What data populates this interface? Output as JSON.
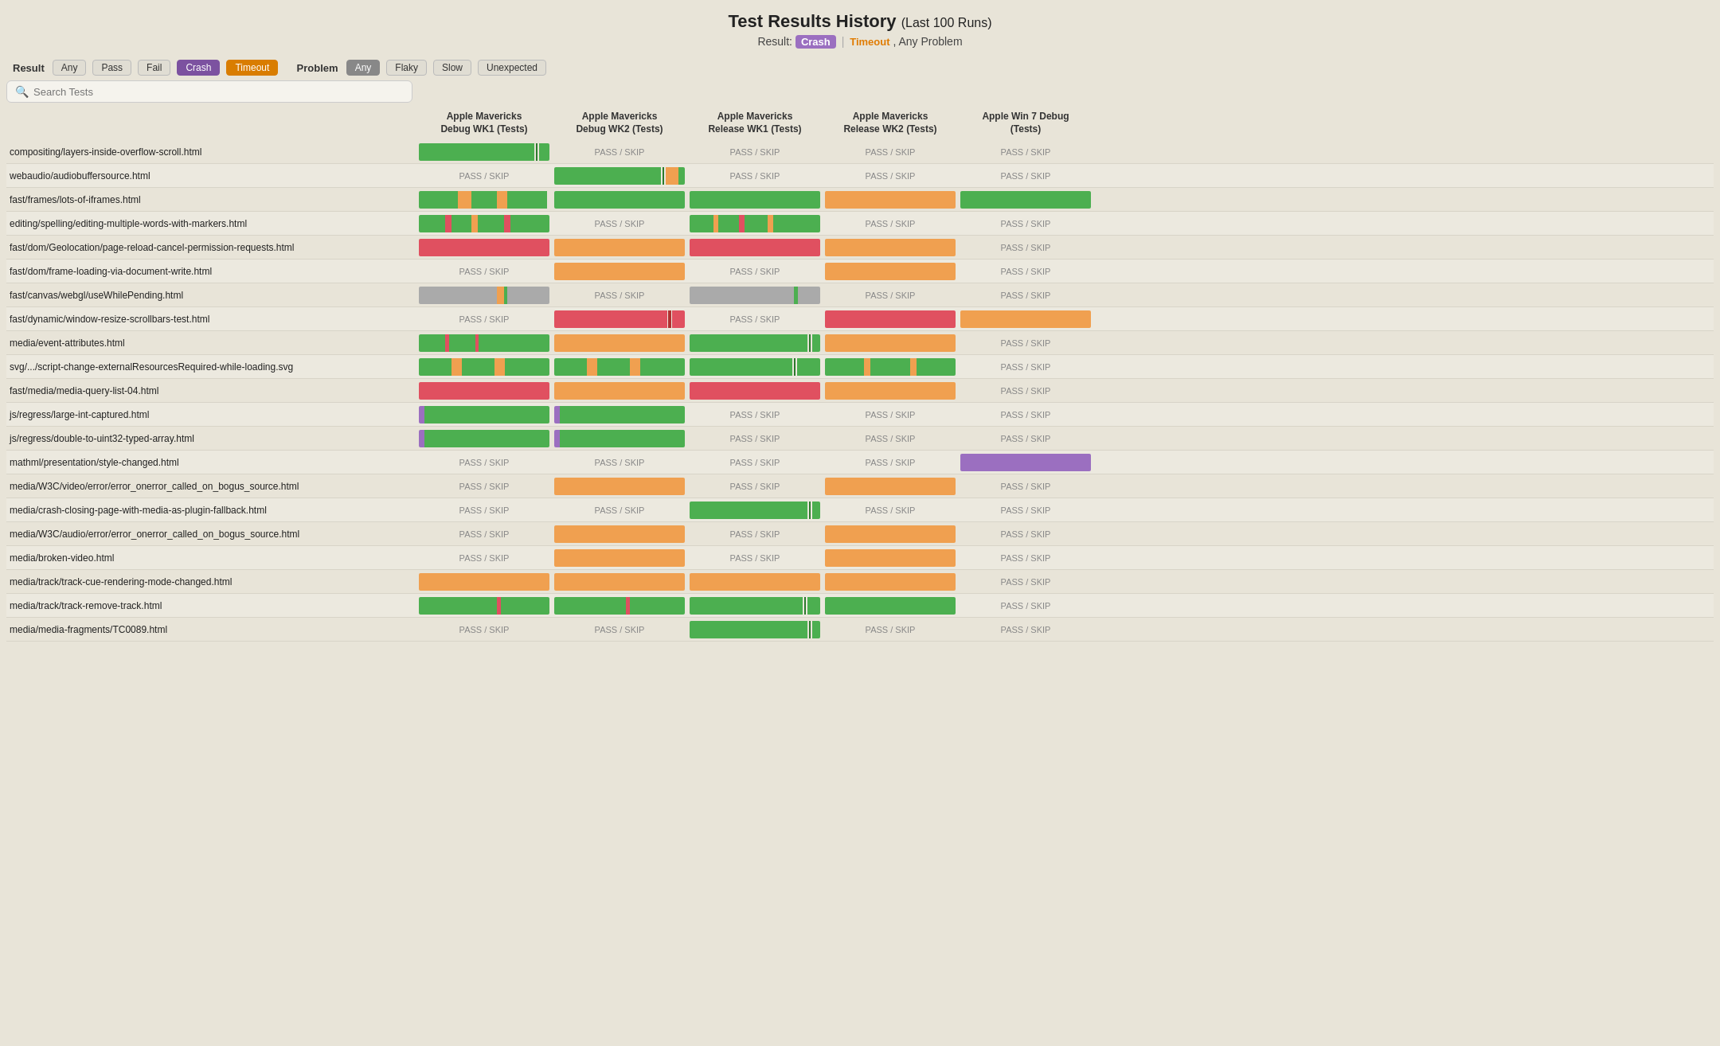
{
  "header": {
    "title": "Test Results History",
    "subtitle": "(Last 100 Runs)",
    "result_label": "Result:",
    "crash_badge": "Crash",
    "separator": "|",
    "timeout_label": "Timeout",
    "any_problem": ", Any Problem"
  },
  "filters": {
    "result_label": "Result",
    "problem_label": "Problem",
    "result_options": [
      "Any",
      "Pass",
      "Fail",
      "Crash",
      "Timeout"
    ],
    "result_active": [
      "Crash",
      "Timeout"
    ],
    "problem_options": [
      "Any",
      "Flaky",
      "Slow",
      "Unexpected"
    ],
    "problem_active": [
      "Any"
    ]
  },
  "search": {
    "placeholder": "Search Tests"
  },
  "columns": [
    "",
    "Apple Mavericks Debug WK1 (Tests)",
    "Apple Mavericks Debug WK2 (Tests)",
    "Apple Mavericks Release WK1 (Tests)",
    "Apple Mavericks Release WK2 (Tests)",
    "Apple Win 7 Debug (Tests)"
  ],
  "rows": [
    {
      "name": "compositing/layers-inside-overflow-scroll.html",
      "cells": [
        "green_chart_1",
        "pass_skip",
        "pass_skip",
        "pass_skip",
        "pass_skip"
      ]
    },
    {
      "name": "webaudio/audiobuffersource.html",
      "cells": [
        "pass_skip",
        "green_chart_2",
        "pass_skip",
        "pass_skip",
        "pass_skip"
      ]
    },
    {
      "name": "fast/frames/lots-of-iframes.html",
      "cells": [
        "mixed_chart_3",
        "green_chart_4",
        "green_chart_5",
        "orange_chart_1",
        "green_chart_6"
      ]
    },
    {
      "name": "editing/spelling/editing-multiple-words-with-markers.html",
      "cells": [
        "striped_chart_1",
        "pass_skip",
        "striped_chart_2",
        "pass_skip",
        "pass_skip"
      ]
    },
    {
      "name": "fast/dom/Geolocation/page-reload-cancel-permission-requests.html",
      "cells": [
        "red_chart_1",
        "orange_chart_2",
        "red_chart_2",
        "orange_chart_3",
        "pass_skip"
      ]
    },
    {
      "name": "fast/dom/frame-loading-via-document-write.html",
      "cells": [
        "pass_skip",
        "orange_chart_4",
        "pass_skip",
        "orange_chart_5",
        "pass_skip"
      ]
    },
    {
      "name": "fast/canvas/webgl/useWhilePending.html",
      "cells": [
        "gray_small_1",
        "pass_skip",
        "gray_small_2",
        "pass_skip",
        "pass_skip"
      ]
    },
    {
      "name": "fast/dynamic/window-resize-scrollbars-test.html",
      "cells": [
        "pass_skip",
        "red_chart_3",
        "pass_skip",
        "red_chart_4",
        "orange_chart_6"
      ]
    },
    {
      "name": "media/event-attributes.html",
      "cells": [
        "striped_green_1",
        "orange_chart_7",
        "green_small_1",
        "orange_chart_8",
        "pass_skip"
      ]
    },
    {
      "name": "svg/.../script-change-externalResourcesRequired-while-loading.svg",
      "cells": [
        "mixed_chart_7",
        "mixed_chart_8",
        "green_chart_9",
        "mixed_chart_9",
        "pass_skip"
      ]
    },
    {
      "name": "fast/media/media-query-list-04.html",
      "cells": [
        "red_chart_5",
        "orange_chart_9",
        "red_chart_6",
        "orange_chart_10",
        "pass_skip"
      ]
    },
    {
      "name": "js/regress/large-int-captured.html",
      "cells": [
        "green_purple_1",
        "green_purple_2",
        "pass_skip",
        "pass_skip",
        "pass_skip"
      ]
    },
    {
      "name": "js/regress/double-to-uint32-typed-array.html",
      "cells": [
        "green_purple_3",
        "green_purple_4",
        "pass_skip",
        "pass_skip",
        "pass_skip"
      ]
    },
    {
      "name": "mathml/presentation/style-changed.html",
      "cells": [
        "pass_skip",
        "pass_skip",
        "pass_skip",
        "pass_skip",
        "purple_chart_1"
      ]
    },
    {
      "name": "media/W3C/video/error/error_onerror_called_on_bogus_source.html",
      "cells": [
        "pass_skip",
        "orange_chart_11",
        "pass_skip",
        "orange_chart_12",
        "pass_skip"
      ]
    },
    {
      "name": "media/crash-closing-page-with-media-as-plugin-fallback.html",
      "cells": [
        "pass_skip",
        "pass_skip",
        "green_small_2",
        "pass_skip",
        "pass_skip"
      ]
    },
    {
      "name": "media/W3C/audio/error/error_onerror_called_on_bogus_source.html",
      "cells": [
        "pass_skip",
        "orange_chart_13",
        "pass_skip",
        "orange_chart_14",
        "pass_skip"
      ]
    },
    {
      "name": "media/broken-video.html",
      "cells": [
        "pass_skip",
        "orange_chart_15",
        "pass_skip",
        "orange_chart_16",
        "pass_skip"
      ]
    },
    {
      "name": "media/track/track-cue-rendering-mode-changed.html",
      "cells": [
        "orange_chart_17",
        "orange_chart_18",
        "orange_chart_19",
        "orange_chart_20",
        "pass_skip"
      ]
    },
    {
      "name": "media/track/track-remove-track.html",
      "cells": [
        "green_chart_10",
        "green_chart_11",
        "green_chart_12",
        "green_chart_13",
        "pass_skip"
      ]
    },
    {
      "name": "media/media-fragments/TC0089.html",
      "cells": [
        "pass_skip",
        "pass_skip",
        "green_small_3",
        "pass_skip",
        "pass_skip"
      ]
    }
  ]
}
